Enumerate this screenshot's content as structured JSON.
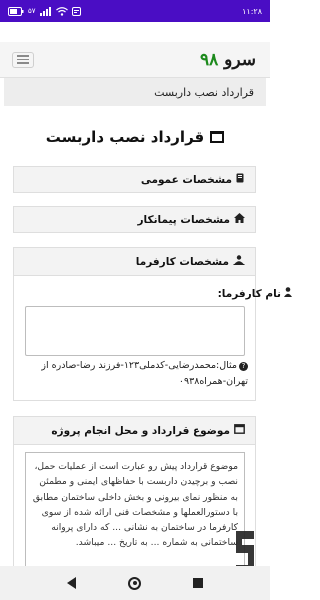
{
  "status_bar": {
    "time": "۱۱:۲۸",
    "battery_percent": "۵۷",
    "icons": [
      "wifi-icon",
      "signal-icon",
      "notification-icon",
      "battery-icon"
    ],
    "bg_color": "#4a0dc4"
  },
  "navbar": {
    "brand_part1": "سرو",
    "brand_part2": "۹۸",
    "brand_color_1": "#1a1a1a",
    "brand_color_2": "#1c8a1c",
    "menu_icon": "hamburger-icon"
  },
  "breadcrumb": {
    "label": "قرارداد نصب داربست"
  },
  "page": {
    "title": "قرارداد نصب داربست",
    "title_icon": "window-icon"
  },
  "sections": {
    "general": {
      "label": "مشخصات عمومی",
      "icon": "book-icon"
    },
    "contractor": {
      "label": "مشخصات پیمانکار",
      "icon": "home-icon"
    },
    "employer": {
      "label": "مشخصات کارفرما",
      "icon": "user-group-icon",
      "field_label": "نام کارفرما:",
      "field_icon": "user-icon",
      "hint": "مثال:محمدرضایی-کدملی۱۲۳-فرزند رضا-صادره از تهران-همراه۰۹۳۸"
    },
    "subject": {
      "label": "موضوع قرارداد و محل انجام پروژه",
      "icon": "window-icon",
      "text": "موضوع قرارداد پیش رو عبارت است از عملیات حمل، نصب و برچیدن داربست با حفاظهای ایمنی و مطمئن به منظور نمای بیرونی و بخش داخلی ساختمان مطابق با دستورالعملها و مشخصات فنی ارائه شده از سوی کارفرما در ساختمان به نشانی ... که دارای پروانه ساختمانی به شماره ... به تاریخ ... میباشد."
    }
  },
  "bottom_nav": {
    "items": [
      "back-icon",
      "home-icon",
      "recent-apps-icon"
    ]
  }
}
